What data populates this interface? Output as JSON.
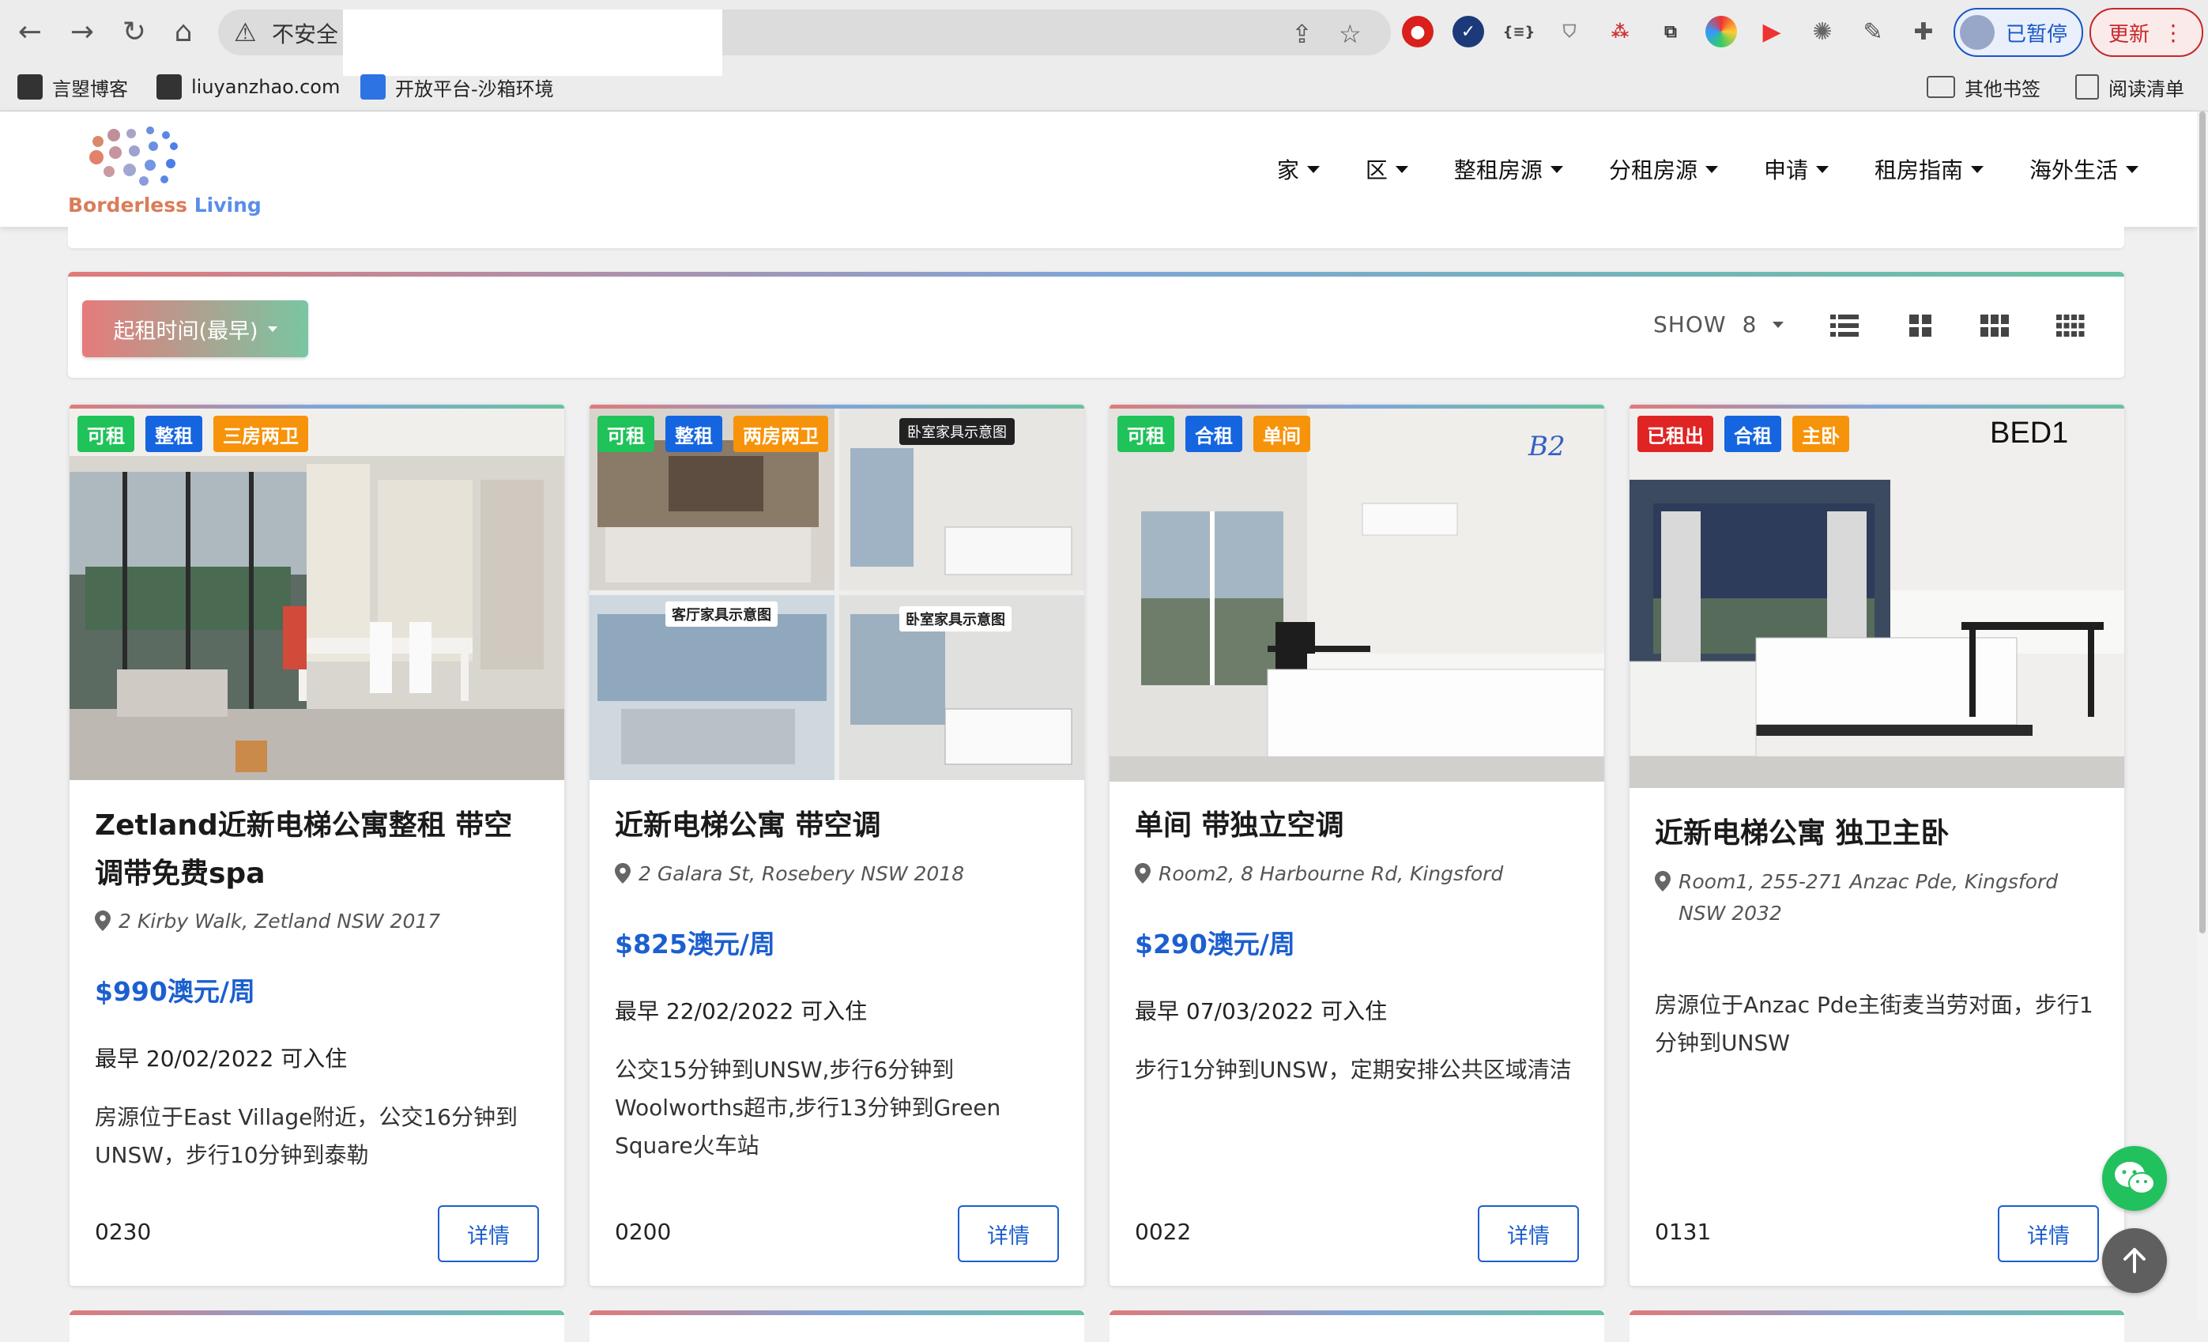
{
  "browser": {
    "security_label": "不安全",
    "pause_label": "已暂停",
    "update_label": "更新",
    "bookmarks": [
      "言曌博客",
      "liuyanzhao.com",
      "开放平台-沙箱环境"
    ],
    "other_bookmarks": "其他书签",
    "reading_list": "阅读清单"
  },
  "site": {
    "logo_word1": "Borderless",
    "logo_word2": "Living",
    "nav": [
      "家",
      "区",
      "整租房源",
      "分租房源",
      "申请",
      "租房指南",
      "海外生活"
    ]
  },
  "filter": {
    "sort_label": "起租时间(最早)",
    "show_label": "SHOW",
    "show_value": "8"
  },
  "listings": [
    {
      "badges": [
        "可租",
        "整租",
        "三房两卫"
      ],
      "title": "Zetland近新电梯公寓整租 带空调带免费spa",
      "address": "2 Kirby Walk, Zetland NSW 2017",
      "price": "$990澳元/周",
      "available": "最早 20/02/2022 可入住",
      "description": "房源位于East Village附近，公交16分钟到UNSW，步行10分钟到泰勒",
      "code": "0230",
      "button": "详情"
    },
    {
      "badges": [
        "可租",
        "整租",
        "两房两卫"
      ],
      "photo_labels": [
        "卧室家具示意图",
        "客厅家具示意图",
        "卧室家具示意图"
      ],
      "title": "近新电梯公寓 带空调",
      "address": "2 Galara St, Rosebery NSW 2018",
      "price": "$825澳元/周",
      "available": "最早 22/02/2022 可入住",
      "description": "公交15分钟到UNSW,步行6分钟到Woolworths超市,步行13分钟到Green Square火车站",
      "code": "0200",
      "button": "详情"
    },
    {
      "badges": [
        "可租",
        "合租",
        "单间"
      ],
      "photo_labels": [
        "B2"
      ],
      "title": "单间 带独立空调",
      "address": "Room2, 8 Harbourne Rd, Kingsford",
      "price": "$290澳元/周",
      "available": "最早 07/03/2022 可入住",
      "description": "步行1分钟到UNSW，定期安排公共区域清洁",
      "code": "0022",
      "button": "详情"
    },
    {
      "badges": [
        "已租出",
        "合租",
        "主卧"
      ],
      "photo_labels": [
        "BED1"
      ],
      "title": "近新电梯公寓 独卫主卧",
      "address": "Room1, 255-271 Anzac Pde, Kingsford NSW 2032",
      "price": "",
      "available": "",
      "description": "房源位于Anzac Pde主街麦当劳对面，步行1分钟到UNSW",
      "code": "0131",
      "button": "详情"
    }
  ],
  "colors": {
    "accent_blue": "#1c5fcf",
    "badge_available": "#20c25a",
    "badge_type": "#1565e0",
    "badge_rooms": "#f7930a",
    "badge_rented": "#e02424",
    "wechat": "#21c15d"
  },
  "icons": [
    "back-icon",
    "forward-icon",
    "reload-icon",
    "home-icon",
    "warning-icon",
    "share-icon",
    "star-icon",
    "extension-icon",
    "wechat-icon",
    "arrow-up-icon",
    "map-pin-icon",
    "list-view-icon",
    "grid-view-icon"
  ]
}
